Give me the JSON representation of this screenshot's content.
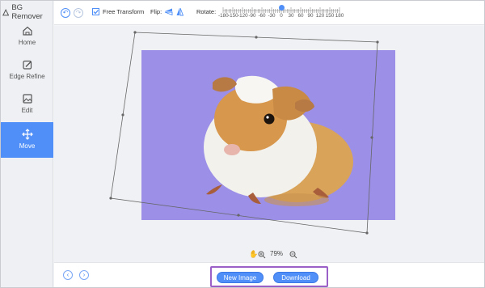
{
  "app": {
    "title": "BG Remover"
  },
  "sidebar": {
    "items": [
      {
        "label": "Home",
        "icon": "home-icon"
      },
      {
        "label": "Edge Refine",
        "icon": "edge-refine-icon"
      },
      {
        "label": "Edit",
        "icon": "edit-image-icon"
      },
      {
        "label": "Move",
        "icon": "move-arrows-icon",
        "active": true
      }
    ]
  },
  "toolbar": {
    "free_transform_label": "Free Transform",
    "free_transform_checked": true,
    "flip_label": "Flip:",
    "rotate_label": "Rotate:",
    "rotate_ticks": [
      "-180",
      "-150",
      "-120",
      "-90",
      "-60",
      "-30",
      "0",
      "30",
      "60",
      "90",
      "120",
      "150",
      "180"
    ],
    "rotate_value": 0
  },
  "zoom": {
    "level": "79%"
  },
  "footer": {
    "new_image_label": "New Image",
    "download_label": "Download"
  },
  "colors": {
    "accent": "#4f8ff7",
    "canvas_bg": "#9b8fe8",
    "highlight_box": "#9b5fc8"
  }
}
